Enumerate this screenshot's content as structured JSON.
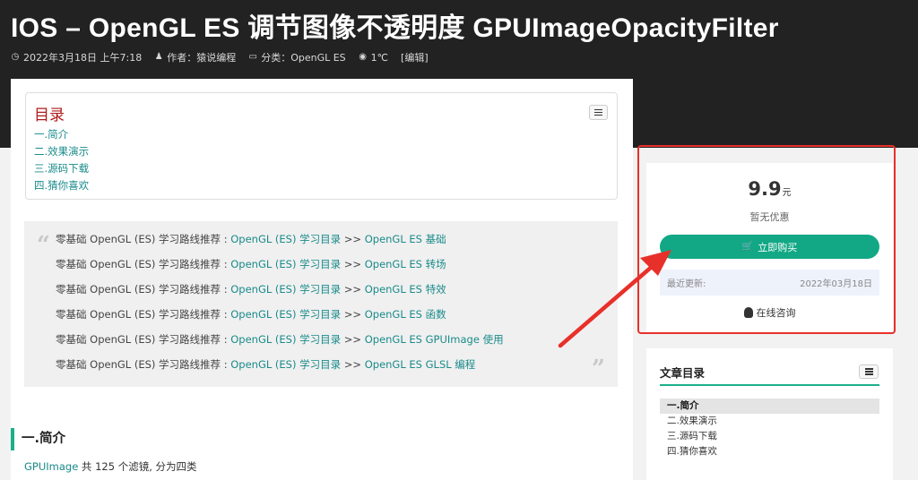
{
  "header": {
    "title": "IOS  –  OpenGL ES 调节图像不透明度 GPUImageOpacityFilter",
    "meta": {
      "date": "2022年3月18日 上午7:18",
      "author": "作者：猿说编程",
      "category": "分类：OpenGL ES",
      "views": "1℃",
      "edit": "[编辑]"
    }
  },
  "toc": {
    "title": "目录",
    "items": [
      "一.简介",
      "二.效果演示",
      "三.源码下载",
      "四.猜你喜欢"
    ]
  },
  "quote": {
    "prefix": "零基础 OpenGL (ES) 学习路线推荐 : ",
    "catalog": "OpenGL (ES) 学习目录",
    "sep": " >> ",
    "links": [
      "OpenGL ES 基础",
      "OpenGL ES 转场",
      "OpenGL ES 特效",
      "OpenGL ES 函数",
      "OpenGL ES GPUImage 使用",
      "OpenGL ES GLSL 编程"
    ]
  },
  "section": {
    "title": "一.简介",
    "para_link": "GPUImage",
    "para_text": " 共 125 个滤镜, 分为四类"
  },
  "purchase": {
    "price": "9.9",
    "unit": "元",
    "discount": "暂无优惠",
    "buy_label": "立即购买",
    "update_label": "最近更新:",
    "update_date": "2022年03月18日",
    "consult_label": "在线咨询"
  },
  "sidebar_toc": {
    "title": "文章目录",
    "items": [
      "一.简介",
      "二.效果演示",
      "三.源码下载",
      "四.猜你喜欢"
    ]
  },
  "colors": {
    "accent": "#12a885",
    "link": "#1a8a8a",
    "highlight": "#e8302a",
    "header_bg": "#222222"
  },
  "icons": {
    "date": "clock-icon",
    "author": "user-icon",
    "category": "folder-icon",
    "views": "eye-icon",
    "cart": "cart-icon",
    "consult": "qq-icon"
  }
}
